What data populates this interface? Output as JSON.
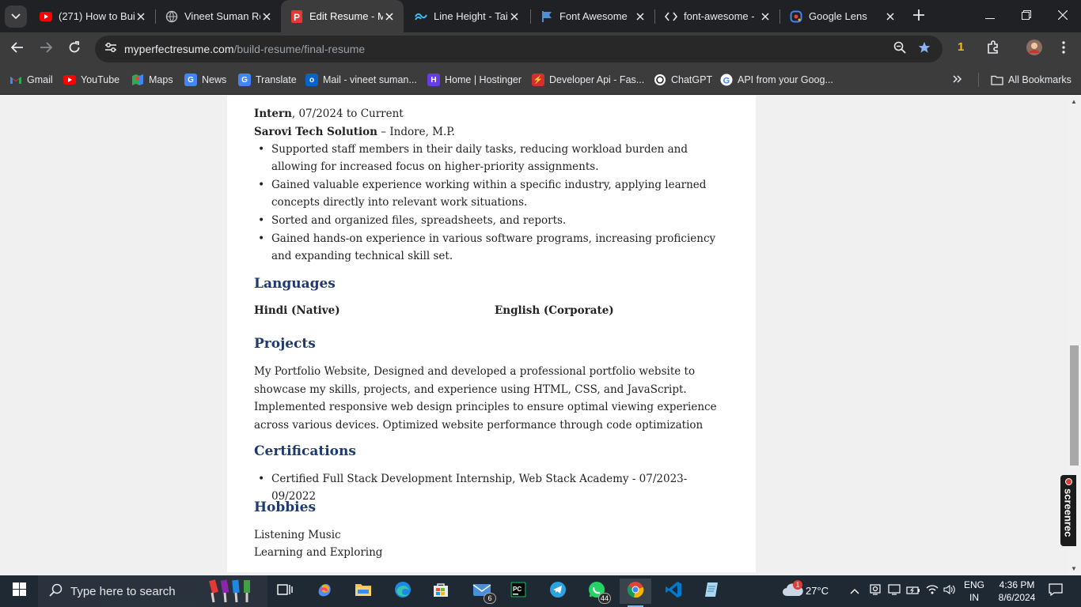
{
  "browser": {
    "tabs": [
      {
        "title": "(271) How to Bui",
        "icon": "youtube-icon"
      },
      {
        "title": "Vineet Suman Re",
        "icon": "globe-icon"
      },
      {
        "title": "Edit Resume - M",
        "icon": "myperfectresume-icon",
        "active": true
      },
      {
        "title": "Line Height - Tai",
        "icon": "tailwind-icon"
      },
      {
        "title": "Font Awesome",
        "icon": "font-awesome-icon"
      },
      {
        "title": "font-awesome - ",
        "icon": "code-icon"
      },
      {
        "title": "Google Lens",
        "icon": "google-lens-icon"
      }
    ],
    "url_domain": "myperfectresume.com",
    "url_path": "/build-resume/final-resume",
    "extension_count": "1",
    "bookmarks": [
      {
        "label": "Gmail",
        "icon": "gmail-icon"
      },
      {
        "label": "YouTube",
        "icon": "youtube-icon"
      },
      {
        "label": "Maps",
        "icon": "maps-icon"
      },
      {
        "label": "News",
        "icon": "news-icon"
      },
      {
        "label": "Translate",
        "icon": "translate-icon"
      },
      {
        "label": "Mail - vineet suman...",
        "icon": "outlook-icon"
      },
      {
        "label": "Home | Hostinger",
        "icon": "hostinger-icon"
      },
      {
        "label": "Developer Api - Fas...",
        "icon": "developer-api-icon"
      },
      {
        "label": "ChatGPT",
        "icon": "chatgpt-icon"
      },
      {
        "label": "API from your Goog...",
        "icon": "google-icon"
      }
    ],
    "all_bookmarks": "All Bookmarks"
  },
  "resume": {
    "job": {
      "title": "Intern",
      "dates": ", 07/2024 to Current",
      "company": "Sarovi Tech Solution",
      "location": " – Indore, M.P.",
      "bullets": [
        "Supported staff members in their daily tasks, reducing workload burden and allowing for increased focus on higher-priority assignments.",
        "Gained valuable experience working within a specific industry, applying learned concepts directly into relevant work situations.",
        "Sorted and organized files, spreadsheets, and reports.",
        "Gained hands-on experience in various software programs, increasing proficiency and expanding technical skill set."
      ]
    },
    "languages_heading": "Languages",
    "languages": [
      "Hindi (Native)",
      "English (Corporate)"
    ],
    "projects_heading": "Projects",
    "projects_text": "My Portfolio Website, Designed and developed a professional portfolio website to showcase my skills, projects, and experience using HTML, CSS, and JavaScript. Implemented responsive web design principles to ensure optimal viewing experience across various devices. Optimized website performance through code optimization",
    "certifications_heading": "Certifications",
    "certifications": [
      "Certified Full Stack Development Internship, Web Stack Academy - 07/2023-09/2022"
    ],
    "hobbies_heading": "Hobbies",
    "hobbies": [
      "Listening Music",
      "Learning and Exploring"
    ]
  },
  "overlay": {
    "screenrec_label": "screenrec"
  },
  "taskbar": {
    "search_placeholder": "Type here to search",
    "mail_badge": "6",
    "whatsapp_badge": "44",
    "weather_temp": "27°C",
    "weather_alert": "1",
    "lang_line1": "ENG",
    "lang_line2": "IN",
    "time": "4:36 PM",
    "date": "8/6/2024"
  },
  "colors": {
    "heading": "#1f3a6e",
    "chrome_dark": "#202124",
    "toolbar": "#3c3c3c",
    "taskbar": "#1f2933"
  }
}
